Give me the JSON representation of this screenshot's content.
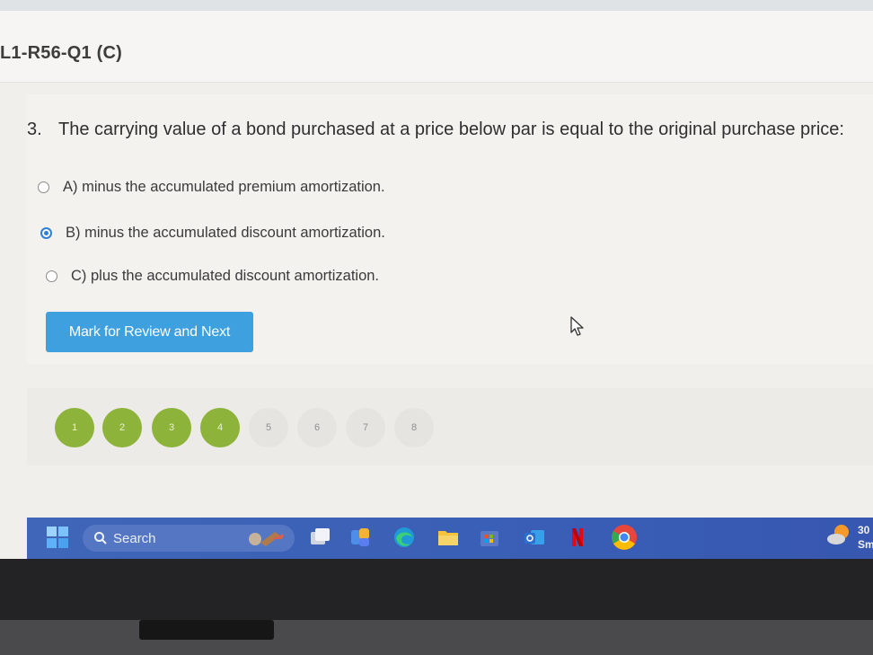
{
  "exam": {
    "title": "L1-R56-Q1 (C)"
  },
  "question": {
    "number": "3.",
    "text": "The carrying value of a bond purchased at a price below par is equal to the original purchase price:",
    "options": [
      {
        "label": "A) minus the accumulated premium amortization.",
        "selected": false
      },
      {
        "label": "B) minus the accumulated discount amortization.",
        "selected": true
      },
      {
        "label": "C) plus the accumulated discount amortization.",
        "selected": false
      }
    ]
  },
  "actions": {
    "review_next_label": "Mark for Review and Next"
  },
  "navigator": {
    "pages": [
      {
        "label": "1",
        "status": "answered"
      },
      {
        "label": "2",
        "status": "answered"
      },
      {
        "label": "3",
        "status": "answered"
      },
      {
        "label": "4",
        "status": "answered"
      },
      {
        "label": "5",
        "status": "unanswered"
      },
      {
        "label": "6",
        "status": "unanswered"
      },
      {
        "label": "7",
        "status": "unanswered"
      },
      {
        "label": "8",
        "status": "unanswered"
      }
    ]
  },
  "taskbar": {
    "search_label": "Search",
    "weather_temp": "30",
    "weather_desc": "Sm",
    "icons": [
      "windows-start-icon",
      "search-icon",
      "copilot-icon",
      "task-view-icon",
      "widgets-icon",
      "edge-icon",
      "file-explorer-icon",
      "microsoft-store-icon",
      "outlook-icon",
      "netflix-icon",
      "chrome-icon",
      "weather-icon"
    ]
  },
  "colors": {
    "accent": "#3ea0de",
    "answered": "#8db33a",
    "unanswered": "#e6e4e0",
    "radio_selected": "#2f7fd8",
    "taskbar": "#3a5fb6"
  }
}
